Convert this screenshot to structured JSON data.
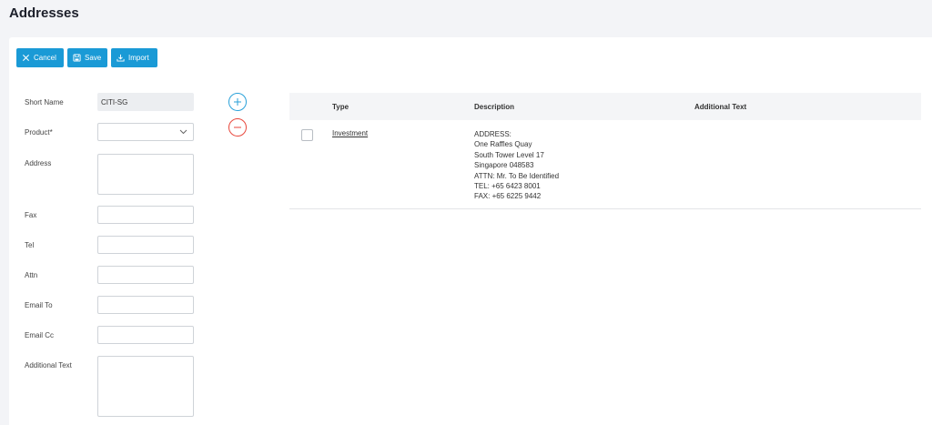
{
  "page": {
    "title": "Addresses"
  },
  "toolbar": {
    "cancel_label": "Cancel",
    "save_label": "Save",
    "import_label": "Import"
  },
  "form": {
    "short_name": {
      "label": "Short Name",
      "value": "CITI-SG"
    },
    "product": {
      "label": "Product*",
      "value": ""
    },
    "address": {
      "label": "Address",
      "value": ""
    },
    "fax": {
      "label": "Fax",
      "value": ""
    },
    "tel": {
      "label": "Tel",
      "value": ""
    },
    "attn": {
      "label": "Attn",
      "value": ""
    },
    "email_to": {
      "label": "Email To",
      "value": ""
    },
    "email_cc": {
      "label": "Email Cc",
      "value": ""
    },
    "additional_text": {
      "label": "Additional Text",
      "value": ""
    }
  },
  "table": {
    "columns": [
      "Type",
      "Description",
      "Additional Text"
    ],
    "rows": [
      {
        "type": "Investment",
        "description": [
          "ADDRESS:",
          "One Raffles Quay",
          "South Tower Level 17",
          "Singapore 048583",
          "ATTN: Mr. To Be Identified",
          "TEL: +65 6423 8001",
          "FAX: +65 6225 9442"
        ],
        "additional_text": ""
      }
    ]
  },
  "colors": {
    "accent": "#1a9ad6",
    "add": "#2aa1d9",
    "remove": "#e8473c"
  },
  "icons": {
    "cancel": "close-icon",
    "save": "save-icon",
    "import": "import-icon",
    "add": "plus-circle-icon",
    "remove": "minus-circle-icon",
    "select": "chevron-down-icon"
  }
}
